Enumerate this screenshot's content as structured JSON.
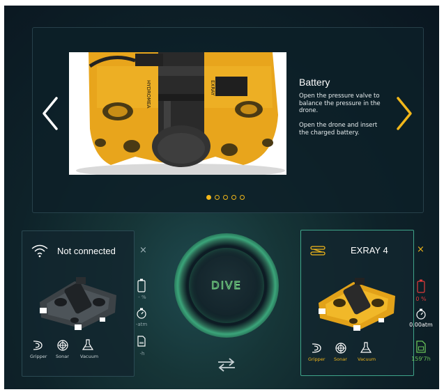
{
  "carousel": {
    "title": "Battery",
    "paragraph1": "Open the pressure valve to balance the pressure in the drone.",
    "paragraph2": "Open the drone and insert the charged battery.",
    "image_labels": [
      "HYDROMEA",
      "EXRAY"
    ],
    "pages": 5,
    "active_page": 1
  },
  "left_card": {
    "title": "Not connected",
    "close": "×",
    "battery": "- %",
    "pressure": "-atm",
    "time": "-h",
    "tools": [
      "Gripper",
      "Sonar",
      "Vacuum"
    ]
  },
  "right_card": {
    "title": "EXRAY 4",
    "close": "×",
    "battery": "0 %",
    "pressure": "0.00atm",
    "time": "159'7h",
    "tools": [
      "Gripper",
      "Sonar",
      "Vacuum"
    ]
  },
  "dive": {
    "label": "DIVE"
  },
  "colors": {
    "accent": "#f2b71a",
    "battery_low": "#e03b3b",
    "green": "#6ac45a",
    "dive_glow": "#3ba57a"
  },
  "icons": {
    "left_card": "wifi-icon",
    "right_card": "link-icon",
    "swap": "swap-arrows-icon"
  }
}
